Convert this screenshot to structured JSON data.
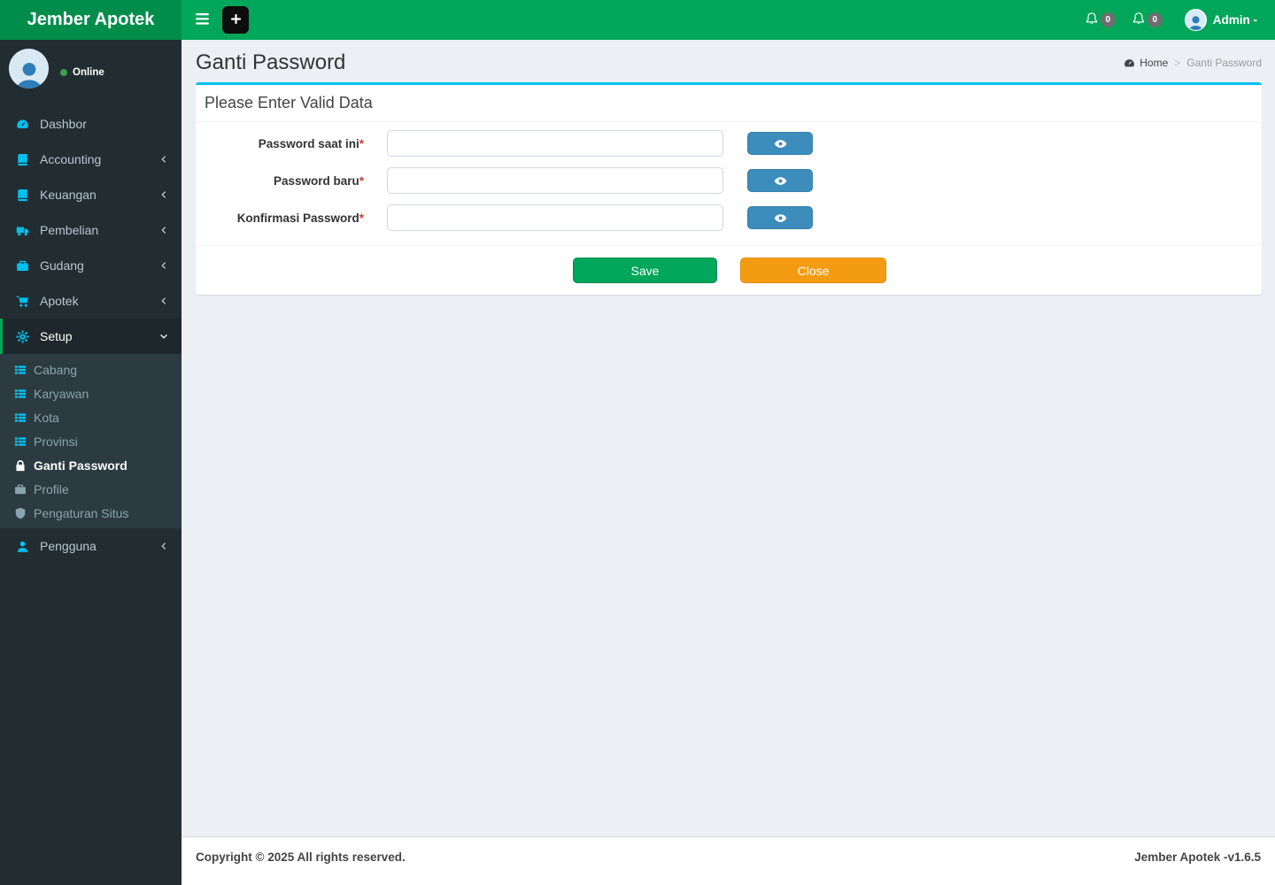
{
  "header": {
    "brand": "Jember Apotek",
    "menu_toggle_icon": "hamburger-icon",
    "add_button_icon": "plus-icon",
    "notifications": [
      {
        "icon": "bell-icon",
        "count": "0"
      },
      {
        "icon": "bell-icon",
        "count": "0"
      }
    ],
    "user": {
      "name": "Admin -",
      "avatar_icon": "person-icon"
    }
  },
  "sidebar": {
    "status": {
      "label": "Online",
      "dot_color": "#3f9e4d",
      "avatar_icon": "person-icon"
    },
    "items": [
      {
        "label": "Dashbor",
        "icon": "gauge-icon"
      },
      {
        "label": "Accounting",
        "icon": "book-icon",
        "chevron": "left"
      },
      {
        "label": "Keuangan",
        "icon": "book-icon",
        "chevron": "left"
      },
      {
        "label": "Pembelian",
        "icon": "truck-icon",
        "chevron": "left"
      },
      {
        "label": "Gudang",
        "icon": "briefcase-icon",
        "chevron": "left"
      },
      {
        "label": "Apotek",
        "icon": "cart-icon",
        "chevron": "left"
      },
      {
        "label": "Setup",
        "icon": "gear-icon",
        "chevron": "down",
        "active": true
      },
      {
        "label": "Pengguna",
        "icon": "user-icon",
        "chevron": "left"
      }
    ],
    "setup_submenu": [
      {
        "label": "Cabang",
        "icon": "list-icon"
      },
      {
        "label": "Karyawan",
        "icon": "list-icon"
      },
      {
        "label": "Kota",
        "icon": "list-icon"
      },
      {
        "label": "Provinsi",
        "icon": "list-icon"
      },
      {
        "label": "Ganti Password",
        "icon": "lock-icon",
        "active": true
      },
      {
        "label": "Profile",
        "icon": "suitcase-icon"
      },
      {
        "label": "Pengaturan Situs",
        "icon": "shield-icon"
      }
    ]
  },
  "content": {
    "title": "Ganti Password",
    "breadcrumb": {
      "home_icon": "gauge-icon",
      "home": "Home",
      "separator": ">",
      "current": "Ganti Password"
    },
    "box": {
      "header": "Please Enter Valid Data",
      "fields": [
        {
          "label": "Password saat ini",
          "required_mark": "*",
          "value": "",
          "toggle_icon": "eye-icon"
        },
        {
          "label": "Password baru",
          "required_mark": "*",
          "value": "",
          "toggle_icon": "eye-icon"
        },
        {
          "label": "Konfirmasi Password",
          "required_mark": "*",
          "value": "",
          "toggle_icon": "eye-icon"
        }
      ],
      "save_label": "Save",
      "close_label": "Close"
    }
  },
  "footer": {
    "left": "Copyright © 2025 All rights reserved.",
    "right": "Jember Apotek -v1.6.5"
  },
  "colors": {
    "navbar_green": "#00a65a",
    "logo_green": "#008d4c",
    "sidebar_dark": "#222d32",
    "submenu_dark": "#2c3b41",
    "accent_cyan": "#00c0ef",
    "primary_blue": "#3c8dbc",
    "success_green": "#00a65a",
    "warning_orange": "#f39c12",
    "badge_gray": "#6e6e6e",
    "content_bg": "#ecf0f5"
  }
}
